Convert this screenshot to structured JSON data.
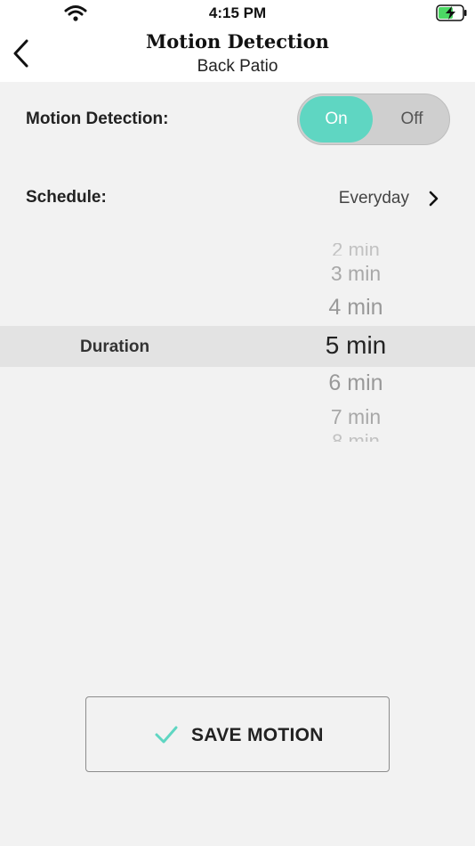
{
  "status_bar": {
    "time": "4:15 PM",
    "wifi_icon": "wifi-icon",
    "battery_icon": "battery-charging-icon",
    "battery_color": "#4cd964"
  },
  "header": {
    "back_icon": "chevron-left-icon",
    "title": "Motion Detection",
    "subtitle": "Back Patio"
  },
  "motion_detection": {
    "label": "Motion Detection:",
    "toggle_on_label": "On",
    "toggle_off_label": "Off",
    "state": "on",
    "accent_color": "#5fd6c2"
  },
  "schedule": {
    "label": "Schedule:",
    "value": "Everyday",
    "chevron_icon": "chevron-right-icon"
  },
  "duration": {
    "label": "Duration",
    "options": [
      "2 min",
      "3 min",
      "4 min",
      "5 min",
      "6 min",
      "7 min",
      "8 min"
    ],
    "selected": "5 min"
  },
  "save_button": {
    "label": "SAVE MOTION",
    "icon": "check-icon",
    "icon_color": "#5fd6c2"
  }
}
